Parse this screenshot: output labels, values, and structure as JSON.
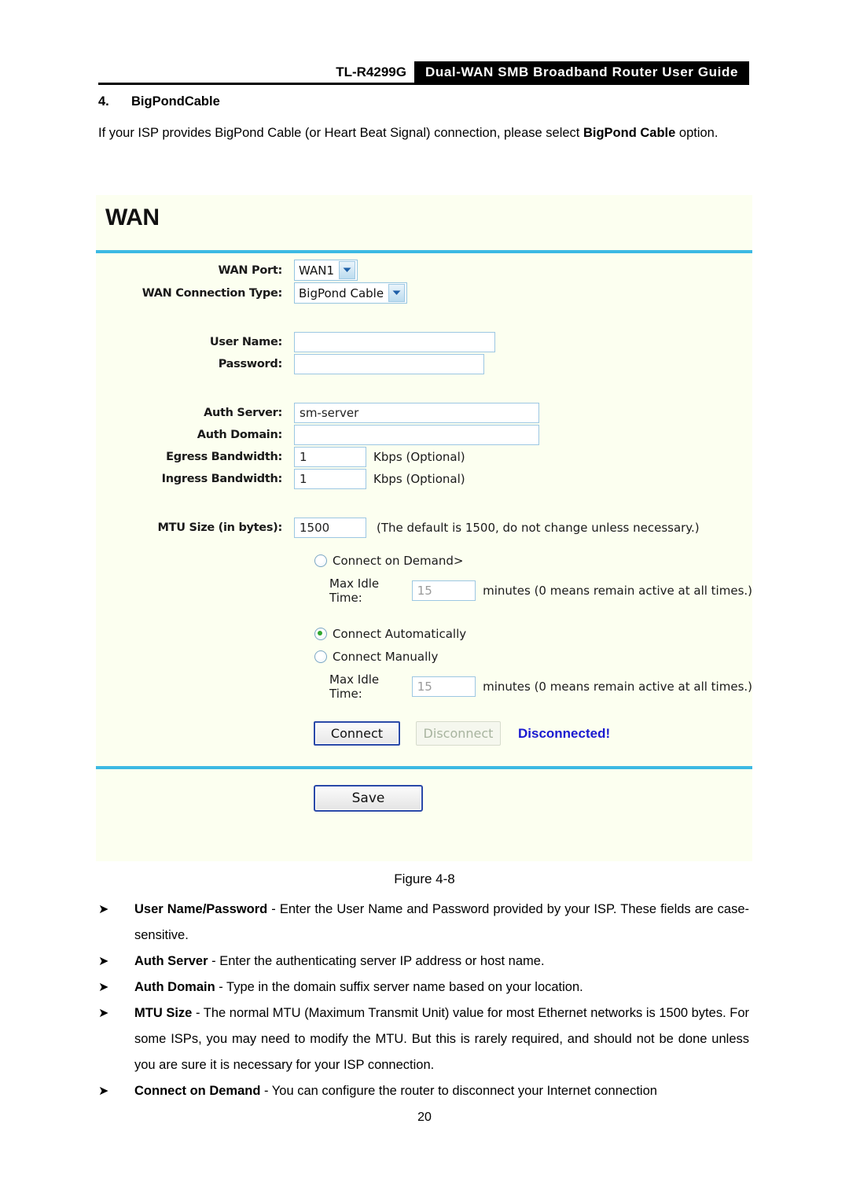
{
  "header": {
    "model": "TL-R4299G",
    "title": "Dual-WAN SMB Broadband Router User Guide"
  },
  "section": {
    "number": "4.",
    "heading": "BigPondCable",
    "intro_prefix": "If your ISP provides BigPond Cable (or Heart Beat Signal) connection, please select ",
    "intro_bold": "BigPond Cable",
    "intro_suffix": " option."
  },
  "ui_panel": {
    "title": "WAN",
    "labels": {
      "wan_port": "WAN Port:",
      "wan_connection_type": "WAN Connection Type:",
      "user_name": "User Name:",
      "password": "Password:",
      "auth_server": "Auth Server:",
      "auth_domain": "Auth Domain:",
      "egress_bandwidth": "Egress Bandwidth:",
      "ingress_bandwidth": "Ingress Bandwidth:",
      "mtu_size": "MTU Size (in bytes):",
      "max_idle_time": "Max Idle Time:"
    },
    "values": {
      "wan_port": "WAN1",
      "wan_connection_type": "BigPond Cable",
      "user_name": "",
      "password": "",
      "auth_server": "sm-server",
      "auth_domain": "",
      "egress_bandwidth": "1",
      "ingress_bandwidth": "1",
      "mtu_size": "1500",
      "max_idle_time_demand": "15",
      "max_idle_time_manual": "15"
    },
    "units": {
      "egress": "Kbps (Optional)",
      "ingress": "Kbps (Optional)",
      "mtu_hint": "(The default is 1500, do not change unless necessary.)",
      "idle_minutes_demand": "minutes (0 means remain active at all times.)",
      "idle_minutes_manual": "minutes (0 means remain active at all times.)"
    },
    "radios": [
      {
        "label": "Connect on Demand>",
        "checked": false
      },
      {
        "label": "Connect Automatically",
        "checked": true
      },
      {
        "label": "Connect Manually",
        "checked": false
      }
    ],
    "buttons": {
      "connect": "Connect",
      "disconnect": "Disconnect",
      "save": "Save"
    },
    "status": "Disconnected!",
    "colors": {
      "panel_bg": "#fcfff0",
      "divider": "#3cb9e3",
      "status": "#1a1ad0",
      "radio_dot": "#2fa72f",
      "button_border": "#2a49a8"
    }
  },
  "figure_caption": "Figure 4-8",
  "bullets": [
    {
      "marker": "➤",
      "term": "User Name/Password",
      "body": " - Enter the User Name and Password provided by your ISP. These fields are case-sensitive."
    },
    {
      "marker": "➤",
      "term": "Auth Server",
      "body": " - Enter the authenticating server IP address or host name."
    },
    {
      "marker": "➤",
      "term": "Auth Domain",
      "body": " - Type in the domain suffix server name based on your location."
    },
    {
      "marker": "➤",
      "term": "MTU Size",
      "body": " - The normal MTU (Maximum Transmit Unit) value for most Ethernet networks is 1500 bytes. For some ISPs, you may need to modify the MTU. But this is rarely required, and should not be done unless you are sure it is necessary for your ISP connection."
    },
    {
      "marker": "➤",
      "term": "Connect on Demand",
      "body": " - You can configure the router to disconnect your Internet connection"
    }
  ],
  "page_number": "20"
}
